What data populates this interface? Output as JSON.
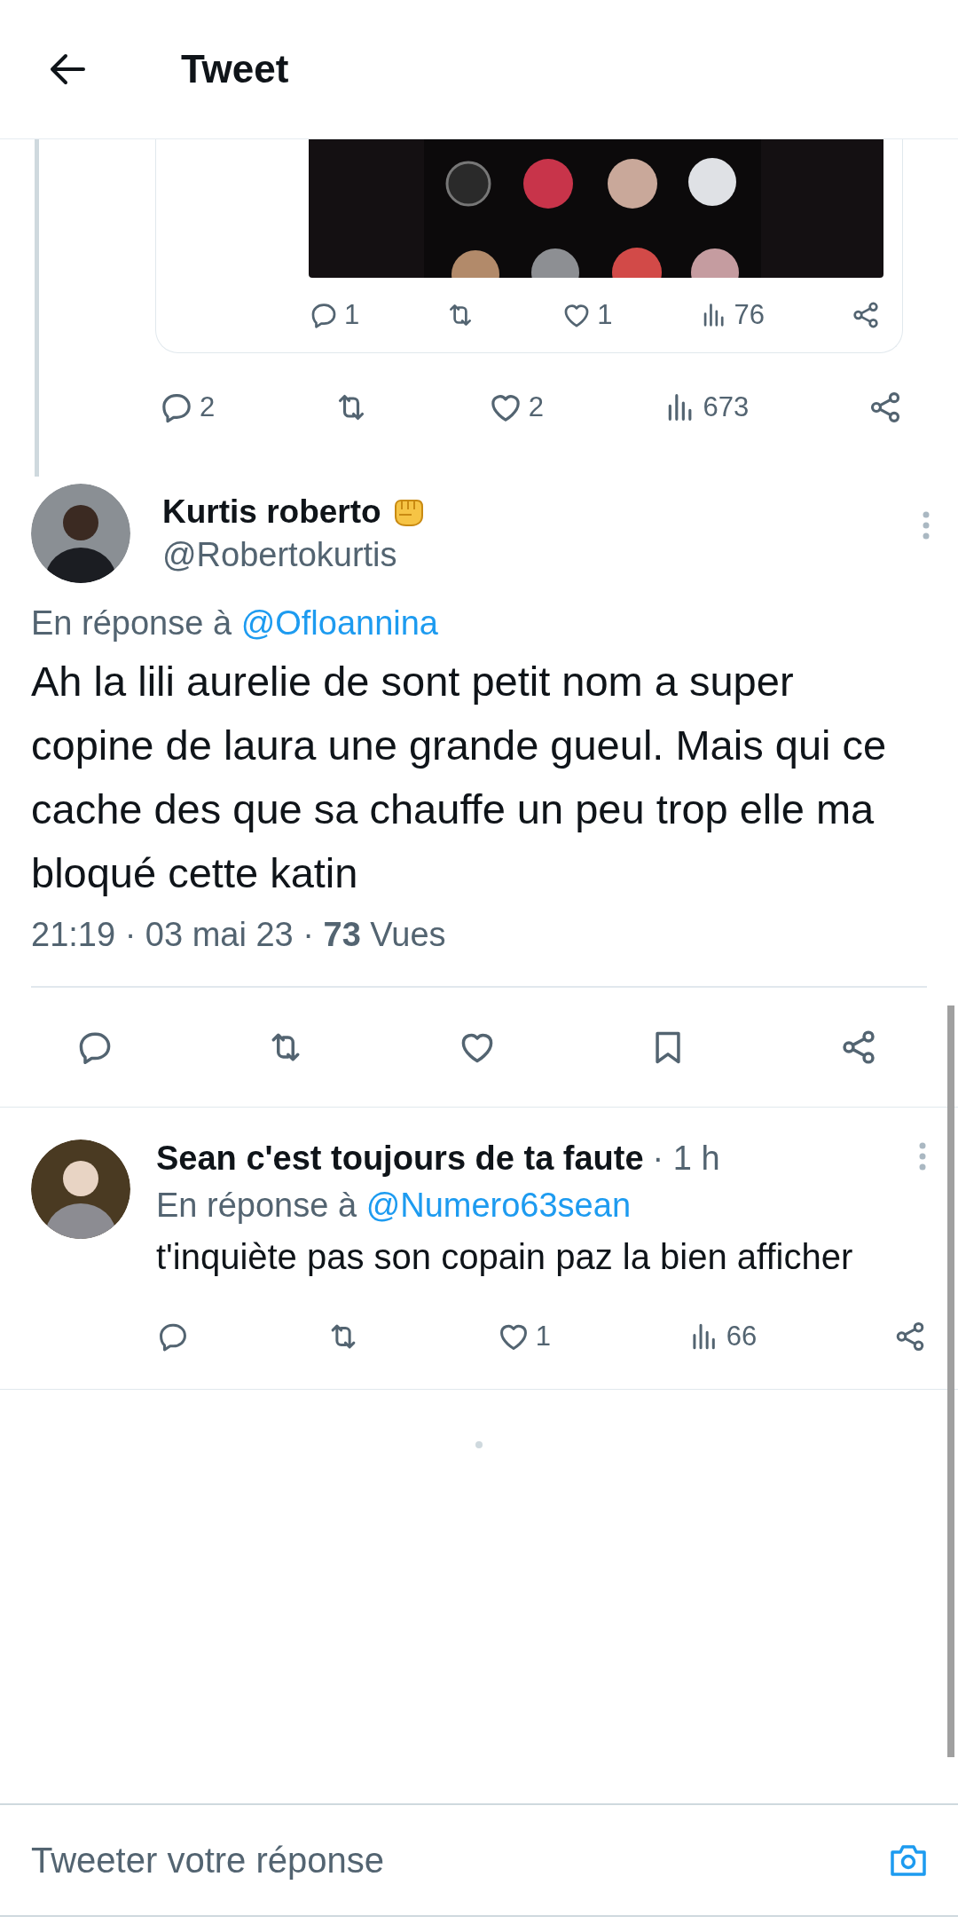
{
  "header": {
    "title": "Tweet"
  },
  "quoted_tweet": {
    "actions": [
      {
        "kind": "reply",
        "count": "1"
      },
      {
        "kind": "retweet"
      },
      {
        "kind": "like",
        "count": "1"
      },
      {
        "kind": "views",
        "count": "76"
      },
      {
        "kind": "share"
      }
    ]
  },
  "parent_actions": [
    {
      "kind": "reply",
      "count": "2"
    },
    {
      "kind": "retweet"
    },
    {
      "kind": "like",
      "count": "2"
    },
    {
      "kind": "views",
      "count": "673"
    },
    {
      "kind": "share"
    }
  ],
  "main_tweet": {
    "name": "Kurtis roberto",
    "handle": "@Robertokurtis",
    "reply_prefix": "En réponse à",
    "reply_to": "@Ofloannina",
    "text": "Ah la lili aurelie de sont petit nom a super copine de laura une grande gueul. Mais qui ce cache des que sa chauffe un peu trop elle ma bloqué cette katin",
    "meta": "21:19 · 03 mai 23 · **73** Vues",
    "actions": [
      {
        "kind": "reply"
      },
      {
        "kind": "retweet"
      },
      {
        "kind": "like"
      },
      {
        "kind": "bookmark"
      },
      {
        "kind": "share"
      }
    ]
  },
  "replies": [
    {
      "name": "Sean c'est toujours de ta faute",
      "time": "· 1 h",
      "reply_prefix": "En réponse à",
      "reply_to": "@Numero63sean",
      "text": "t'inquiète pas son copain paz la bien afficher",
      "actions": [
        {
          "kind": "reply"
        },
        {
          "kind": "retweet"
        },
        {
          "kind": "like",
          "count": "1"
        },
        {
          "kind": "views",
          "count": "66"
        },
        {
          "kind": "share"
        }
      ]
    }
  ],
  "composer": {
    "placeholder": "Tweeter votre réponse"
  }
}
